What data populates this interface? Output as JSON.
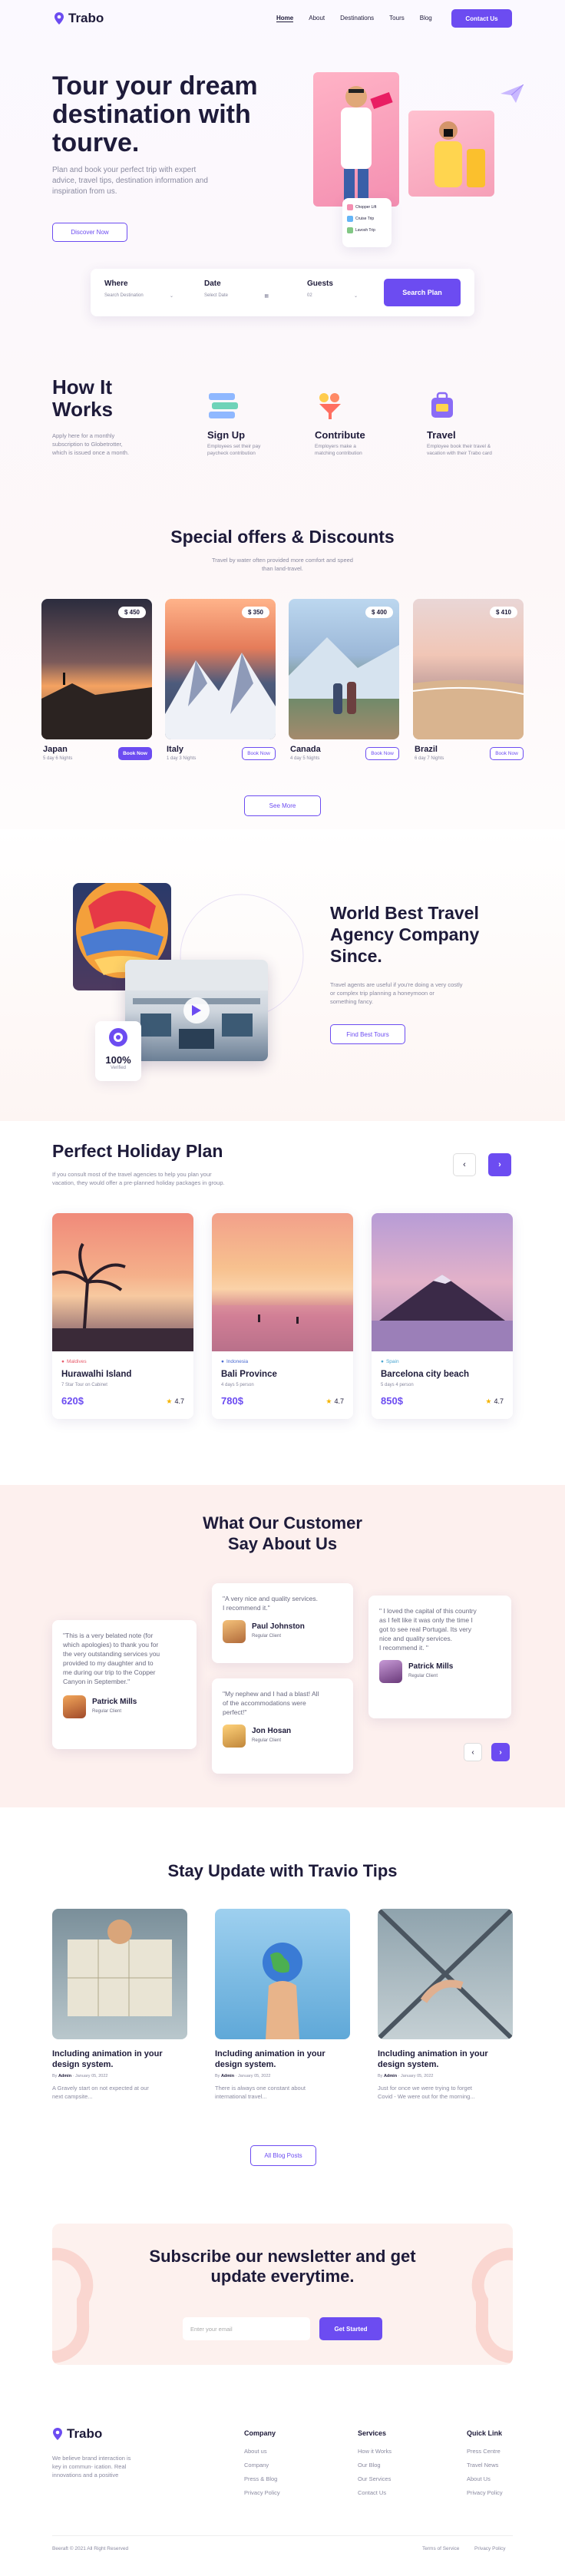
{
  "brand": {
    "name": "Trabo"
  },
  "nav": {
    "items": [
      "Home",
      "About",
      "Destinations",
      "Tours",
      "Blog"
    ],
    "cta": "Contact Us"
  },
  "hero": {
    "title_l1": "Tour your dream",
    "title_l2": "destination with",
    "title_l3": "tourve.",
    "desc_l1": "Plan and book your perfect trip with expert",
    "desc_l2": "advice, travel tips, destination information and",
    "desc_l3": "inspiration from us.",
    "button": "Discover Now",
    "mini_items": [
      "Chopper Lift",
      "Cruise Trip",
      "Lavosh Trip"
    ]
  },
  "search": {
    "where_label": "Where",
    "where_ph": "Search Destination",
    "date_label": "Date",
    "date_ph": "Select Date",
    "guests_label": "Guests",
    "guests_ph": "02",
    "button": "Search Plan"
  },
  "how": {
    "title_l1": "How It",
    "title_l2": "Works",
    "desc_l1": "Apply here for a monthly",
    "desc_l2": "subscription to Globetrotter,",
    "desc_l3": "which is issued once a month.",
    "steps": [
      {
        "title": "Sign Up",
        "d1": "Employees set their pay",
        "d2": "paycheck contribution"
      },
      {
        "title": "Contribute",
        "d1": "Employers make a",
        "d2": "matching contribution"
      },
      {
        "title": "Travel",
        "d1": "Employee book their travel &",
        "d2": "vacation with their Trabo card"
      }
    ]
  },
  "offers": {
    "title": "Special offers & Discounts",
    "desc_l1": "Travel by water often provided more comfort and speed",
    "desc_l2": "than land-travel.",
    "book": "Book Now",
    "more": "See More",
    "items": [
      {
        "name": "Japan",
        "days": "5 day 6 Nights",
        "price": "$ 450"
      },
      {
        "name": "Italy",
        "days": "1 day 3 Nights",
        "price": "$ 350"
      },
      {
        "name": "Canada",
        "days": "4 day 5 Nights",
        "price": "$ 400"
      },
      {
        "name": "Brazil",
        "days": "6 day 7 Nights",
        "price": "$ 410"
      }
    ]
  },
  "agency": {
    "title_l1": "World Best Travel",
    "title_l2": "Agency Company",
    "title_l3": "Since.",
    "desc_l1": "Travel agents are useful if you're doing a very costly",
    "desc_l2": "or complex trip planning a honeymoon or",
    "desc_l3": "something fancy.",
    "button": "Find Best Tours",
    "badge_value": "100%",
    "badge_label": "Verified"
  },
  "holiday": {
    "title": "Perfect Holiday Plan",
    "desc_l1": "If you consult most of the travel agencies to help you plan your",
    "desc_l2": "vacation, they would offer a pre-planned holiday packages in group.",
    "items": [
      {
        "country": "Maldives",
        "name": "Hurawalhi Island",
        "sub": "7 Star Tour on Cabinet",
        "price": "620$",
        "rating": "4.7"
      },
      {
        "country": "Indonesia",
        "name": "Bali Province",
        "sub": "4 days 5 person",
        "price": "780$",
        "rating": "4.7"
      },
      {
        "country": "Spain",
        "name": "Barcelona city beach",
        "sub": "5 days 4 person",
        "price": "850$",
        "rating": "4.7"
      }
    ]
  },
  "testimonials": {
    "title_l1": "What Our Customer",
    "title_l2": "Say About Us",
    "items": [
      {
        "l1": "\"This is a very belated note (for",
        "l2": "which apologies) to thank you for",
        "l3": "the very outstanding services you",
        "l4": "provided to my daughter and to",
        "l5": "me during our trip to the Copper",
        "l6": "Canyon in September.\"",
        "name": "Patrick Mills",
        "role": "Regular Client"
      },
      {
        "l1": "\"A very nice and quality services.",
        "l2": "I recommend it.\"",
        "name": "Paul Johnston",
        "role": "Regular Client"
      },
      {
        "l1": "\"My nephew and I had a blast! All",
        "l2": "of the accommodations were",
        "l3": "perfect!\"",
        "name": "Jon Hosan",
        "role": "Regular Client"
      },
      {
        "l1": "\" I loved the capital of this country",
        "l2": "as I felt like it was only the time I",
        "l3": "got to see real Portugal. Its very",
        "l4": "nice and quality services.",
        "l5": "I recommend it. \"",
        "name": "Patrick Mills",
        "role": "Regular Client"
      }
    ]
  },
  "tips": {
    "title": "Stay Update with Travio Tips",
    "by": "By",
    "author": "Admin",
    "date": "January 05, 2022",
    "all": "All Blog Posts",
    "items": [
      {
        "t1": "Including animation in your",
        "t2": "design system.",
        "d1": "A Gravely start on not expected at our",
        "d2": "next campsite..."
      },
      {
        "t1": "Including animation in your",
        "t2": "design system.",
        "d1": "There is always one constant about",
        "d2": "international travel..."
      },
      {
        "t1": "Including animation in your",
        "t2": "design system.",
        "d1": "Just for once we were trying to forget",
        "d2": "Covid - We were out for the morning..."
      }
    ]
  },
  "newsletter": {
    "title_l1": "Subscribe our newsletter and get",
    "title_l2": "update everytime.",
    "placeholder": "Enter your email",
    "button": "Get Started"
  },
  "footer": {
    "desc_l1": "We believe brand interaction is",
    "desc_l2": "key in commun- ication. Real",
    "desc_l3": "innovations and a positive",
    "cols": [
      {
        "title": "Company",
        "links": [
          "About us",
          "Company",
          "Press & Blog",
          "Privacy Policy"
        ]
      },
      {
        "title": "Services",
        "links": [
          "How it Works",
          "Our Blog",
          "Our Services",
          "Contact Us"
        ]
      },
      {
        "title": "Quick Link",
        "links": [
          "Press Centre",
          "Travel News",
          "About Us",
          "Privacy Policy"
        ]
      }
    ],
    "copyright": "Beeraft © 2021 All Right Reserved",
    "terms": "Terms of Service",
    "privacy": "Privacy Policy"
  },
  "colors": {
    "accent": "#6c4cf1",
    "star": "#f5b400",
    "dark": "#1e1b3a"
  }
}
